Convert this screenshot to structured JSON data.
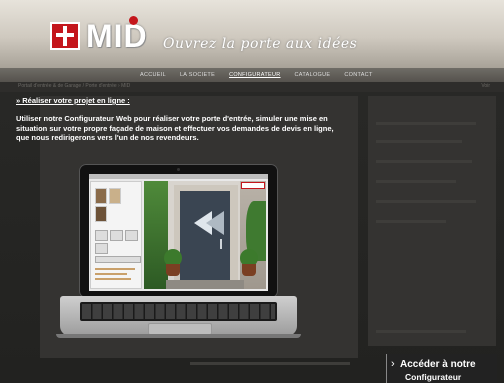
{
  "header": {
    "logo_text": "MID",
    "slogan": "Ouvrez la porte aux idées"
  },
  "nav": {
    "items": [
      {
        "label": "ACCUEIL"
      },
      {
        "label": "LA SOCIETE"
      },
      {
        "label": "CONFIGURATEUR"
      },
      {
        "label": "CATALOGUE"
      },
      {
        "label": "CONTACT"
      }
    ],
    "active": "CONFIGURATEUR"
  },
  "breadcrumb": {
    "text": "Portail d'entrée & de Garage / Porte d'entrée › MID",
    "right": "Voir"
  },
  "modal": {
    "heading": "» Réaliser votre projet en ligne :",
    "intro": "Utiliser notre Configurateur Web pour réaliser votre porte d'entrée, simuler une mise en situation sur votre propre façade de maison et effectuer vos demandes de devis en ligne, que nous redirigerons vers l'un de nos revendeurs."
  },
  "cta": {
    "arrow": "›",
    "line1": "Accéder à notre",
    "line2": "Configurateur"
  },
  "colors": {
    "brand_red": "#c4161c",
    "overlay": "#2a2a28"
  }
}
